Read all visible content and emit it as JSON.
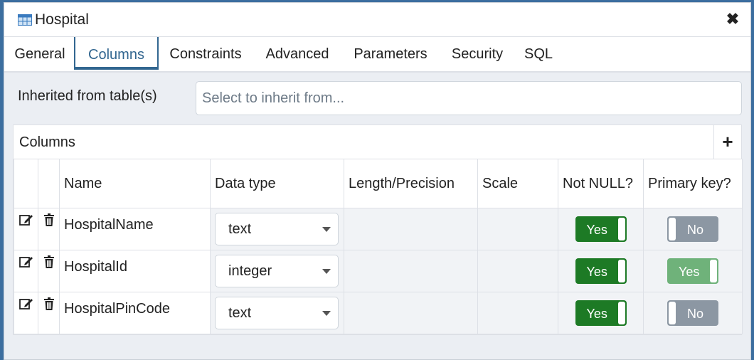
{
  "dialog": {
    "title": "Hospital",
    "close_symbol": "✖",
    "title_icon": "table-icon"
  },
  "tabs": [
    {
      "label": "General",
      "active": false
    },
    {
      "label": "Columns",
      "active": true
    },
    {
      "label": "Constraints",
      "active": false
    },
    {
      "label": "Advanced",
      "active": false
    },
    {
      "label": "Parameters",
      "active": false
    },
    {
      "label": "Security",
      "active": false
    },
    {
      "label": "SQL",
      "active": false
    }
  ],
  "inherit": {
    "label": "Inherited from table(s)",
    "placeholder": "Select to inherit from..."
  },
  "columns_grid": {
    "title": "Columns",
    "add_symbol": "+",
    "headers": {
      "name": "Name",
      "data_type": "Data type",
      "length": "Length/Precision",
      "scale": "Scale",
      "not_null": "Not NULL?",
      "primary_key": "Primary key?"
    },
    "rows": [
      {
        "name": "HospitalName",
        "data_type": "text",
        "not_null": "Yes",
        "primary_key": "No"
      },
      {
        "name": "HospitalId",
        "data_type": "integer",
        "not_null": "Yes",
        "primary_key": "Yes"
      },
      {
        "name": "HospitalPinCode",
        "data_type": "text",
        "not_null": "Yes",
        "primary_key": "No"
      }
    ]
  },
  "colors": {
    "accent": "#326690",
    "toggle_on": "#1d7a25",
    "toggle_on_disabled": "#6fb27a",
    "toggle_off": "#8c97a3"
  }
}
